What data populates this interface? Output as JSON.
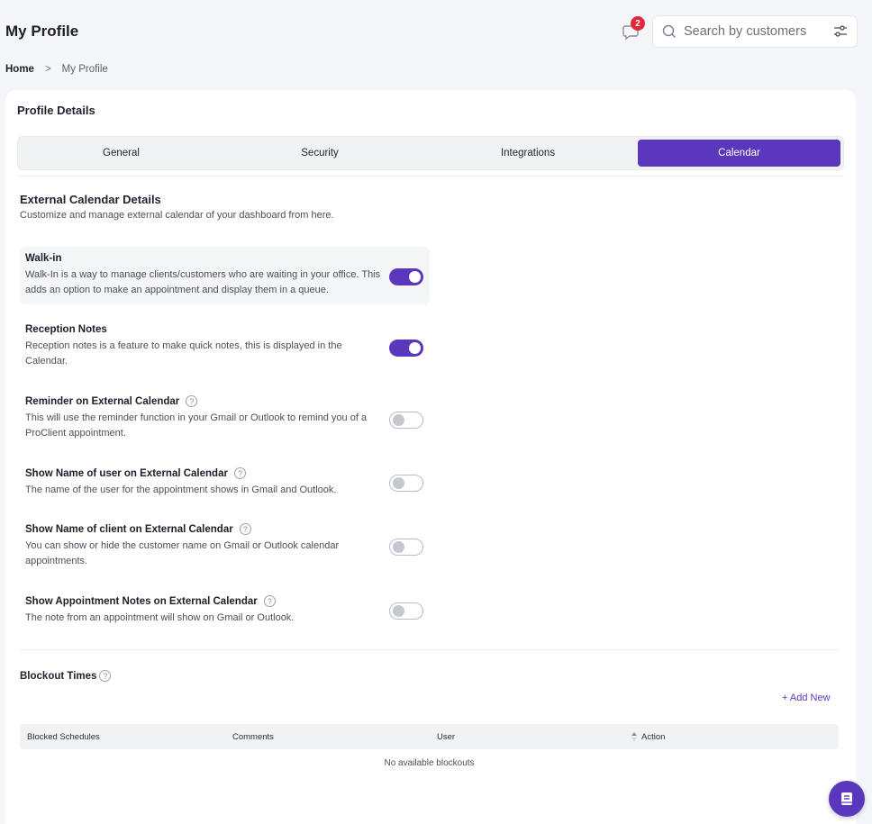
{
  "header": {
    "title": "My Profile",
    "notification_count": "2",
    "search_placeholder": "Search by customers"
  },
  "breadcrumb": {
    "home": "Home",
    "separator": ">",
    "current": "My Profile"
  },
  "card": {
    "title": "Profile Details",
    "tabs": [
      {
        "label": "General",
        "active": false
      },
      {
        "label": "Security",
        "active": false
      },
      {
        "label": "Integrations",
        "active": false
      },
      {
        "label": "Calendar",
        "active": true
      }
    ]
  },
  "calendar": {
    "title": "External Calendar Details",
    "subtitle": "Customize and manage external calendar of your dashboard from here.",
    "settings": [
      {
        "title": "Walk-in",
        "help": false,
        "enabled": true,
        "description": "Walk-In is a way to manage clients/customers who are waiting in your office. This adds an option to make an appointment and display them in a queue."
      },
      {
        "title": "Reception Notes",
        "help": false,
        "enabled": true,
        "description": "Reception notes is a feature to make quick notes, this is displayed in the Calendar."
      },
      {
        "title": "Reminder on External Calendar",
        "help": true,
        "enabled": false,
        "description": "This will use the reminder function in your Gmail or Outlook to remind you of a ProClient appointment."
      },
      {
        "title": "Show Name of user on External Calendar",
        "help": true,
        "enabled": false,
        "description": "The name of the user for the appointment shows in Gmail and Outlook."
      },
      {
        "title": "Show Name of client on External Calendar",
        "help": true,
        "enabled": false,
        "description": "You can show or hide the customer name on Gmail or Outlook calendar appointments."
      },
      {
        "title": "Show Appointment Notes on External Calendar",
        "help": true,
        "enabled": false,
        "description": "The note from an appointment will show on Gmail or Outlook."
      }
    ]
  },
  "blockout": {
    "title": "Blockout Times",
    "add_new": "+ Add New",
    "columns": [
      "Blocked Schedules",
      "Comments",
      "User",
      "Action"
    ],
    "empty_text": "No available blockouts"
  },
  "colors": {
    "accent": "#5b37bd",
    "badge": "#e0283a"
  },
  "icons": [
    "chat-bubble-icon",
    "search-icon",
    "filter-sliders-icon",
    "help-circle-icon",
    "sort-icon",
    "book-icon"
  ]
}
